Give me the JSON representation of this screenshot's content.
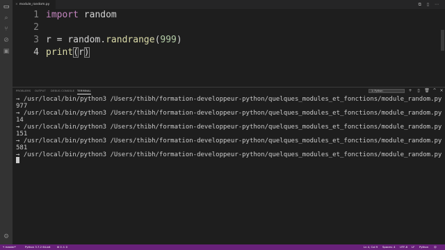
{
  "tabbar": {
    "file_tab": "module_random.py",
    "close_glyph": "×",
    "actions": "⧉ ▯ ⋯"
  },
  "editor": {
    "lines": [
      {
        "num": "1",
        "parts": [
          {
            "t": "import",
            "c": "kw"
          },
          {
            "t": " random",
            "c": ""
          }
        ]
      },
      {
        "num": "2",
        "parts": []
      },
      {
        "num": "3",
        "parts": [
          {
            "t": "r",
            "c": ""
          },
          {
            "t": " = ",
            "c": ""
          },
          {
            "t": "random",
            "c": ""
          },
          {
            "t": ".",
            "c": ""
          },
          {
            "t": "randrange",
            "c": "fn"
          },
          {
            "t": "(",
            "c": ""
          },
          {
            "t": "999",
            "c": "num"
          },
          {
            "t": ")",
            "c": ""
          }
        ]
      },
      {
        "num": "4",
        "parts": [
          {
            "t": "print",
            "c": "fn"
          },
          {
            "t": "(",
            "c": "bracket"
          },
          {
            "t": "r",
            "c": ""
          },
          {
            "t": ")",
            "c": "bracket"
          }
        ]
      }
    ]
  },
  "panel": {
    "tabs": [
      "PROBLEMS",
      "OUTPUT",
      "DEBUG CONSOLE",
      "TERMINAL"
    ],
    "active_tab": "TERMINAL",
    "terminal_select": "1: Python",
    "icons": [
      "+",
      "▯",
      "🗑",
      "^",
      "×"
    ]
  },
  "terminal": {
    "lines": [
      "→ /usr/local/bin/python3 /Users/thibh/formation-developpeur-python/quelques_modules_et_fonctions/module_random.py",
      "977",
      "→ /usr/local/bin/python3 /Users/thibh/formation-developpeur-python/quelques_modules_et_fonctions/module_random.py",
      "14",
      "→ /usr/local/bin/python3 /Users/thibh/formation-developpeur-python/quelques_modules_et_fonctions/module_random.py",
      "151",
      "→ /usr/local/bin/python3 /Users/thibh/formation-developpeur-python/quelques_modules_et_fonctions/module_random.py",
      "581",
      "→ /usr/local/bin/python3 /Users/thibh/formation-developpeur-python/quelques_modules_et_fonctions/module_random.py"
    ]
  },
  "statusbar": {
    "branch": "master*",
    "python": "Python 3.7.2 64-bit",
    "problems": "⊗ 0 ⚠ 0",
    "cursor_pos": "Ln 4, Col 9",
    "spaces": "Spaces: 4",
    "encoding": "UTF-8",
    "eol": "LF",
    "language": "Python",
    "color": "#68217a"
  },
  "activity": {
    "icons": [
      "files-icon",
      "search-icon",
      "source-control-icon",
      "debug-icon",
      "extensions-icon"
    ],
    "settings": "gear-icon"
  }
}
